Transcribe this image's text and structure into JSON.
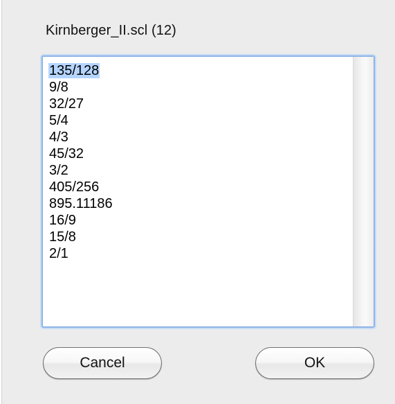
{
  "dialog": {
    "title": "Kirnberger_II.scl (12)",
    "items": [
      "135/128",
      "9/8",
      "32/27",
      "5/4",
      "4/3",
      "45/32",
      "3/2",
      "405/256",
      "895.11186",
      "16/9",
      "15/8",
      "2/1"
    ],
    "selected_index": 0,
    "cancel_label": "Cancel",
    "ok_label": "OK"
  },
  "colors": {
    "selection": "#b5d5ff",
    "focus_ring": "#8eb4e6",
    "dialog_bg": "#ececec"
  }
}
